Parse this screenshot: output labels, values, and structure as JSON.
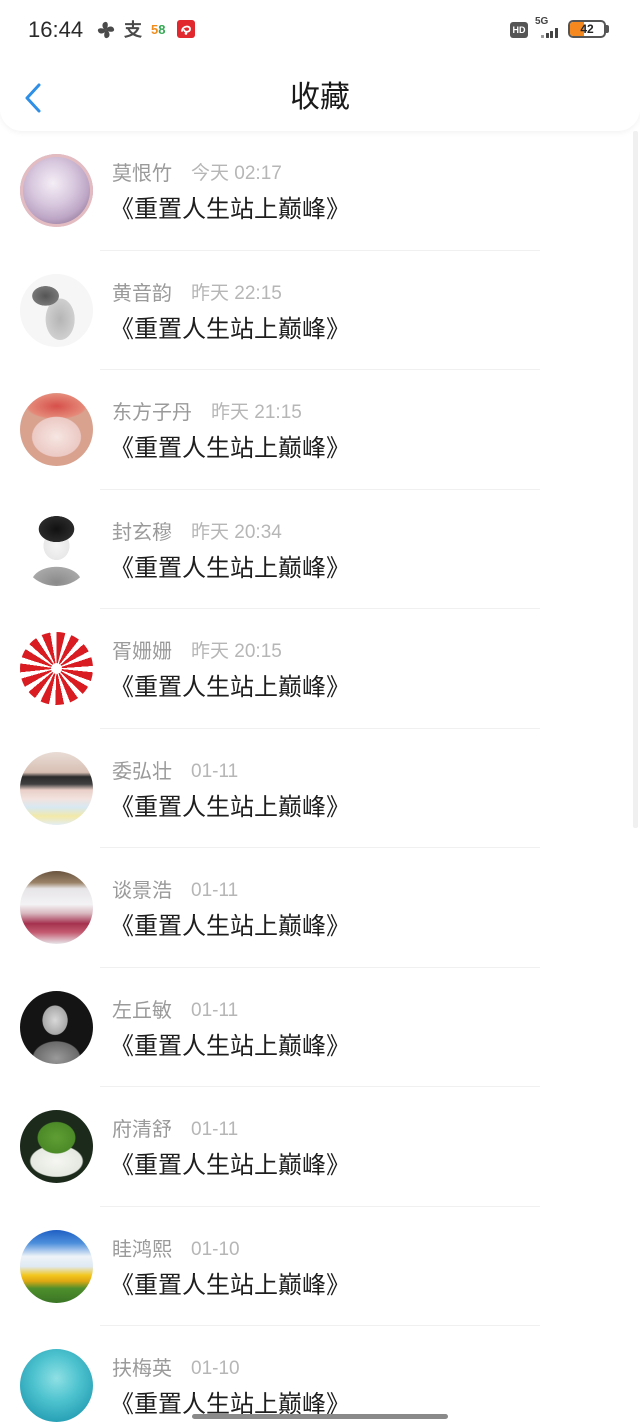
{
  "status_bar": {
    "time": "16:44",
    "app_icons": [
      {
        "icon": "pinwheel-icon"
      },
      {
        "icon": "alipay-icon",
        "glyph": "支"
      },
      {
        "icon": "58-app-icon",
        "glyph": "58"
      },
      {
        "icon": "red-app-icon"
      }
    ],
    "hd_label": "HD",
    "network_label": "5G",
    "battery": {
      "text": "42",
      "level": 0.42,
      "fill_color": "#f5891f"
    }
  },
  "header": {
    "back_icon": "chevron-left-icon",
    "title": "收藏"
  },
  "theme": {
    "accent": "#2f8fe6",
    "name_color": "#9a9a9a",
    "time_color": "#b6b6b6",
    "title_color": "#1e1e1e",
    "header_title_color": "#1a1a1a"
  },
  "items": [
    {
      "name": "莫恨竹",
      "time": "今天 02:17",
      "title": "《重置人生站上巅峰》"
    },
    {
      "name": "黄音韵",
      "time": "昨天 22:15",
      "title": "《重置人生站上巅峰》"
    },
    {
      "name": "东方子丹",
      "time": "昨天 21:15",
      "title": "《重置人生站上巅峰》"
    },
    {
      "name": "封玄穆",
      "time": "昨天 20:34",
      "title": "《重置人生站上巅峰》"
    },
    {
      "name": "胥姗姗",
      "time": "昨天 20:15",
      "title": "《重置人生站上巅峰》"
    },
    {
      "name": "委弘壮",
      "time": "01-11",
      "title": "《重置人生站上巅峰》"
    },
    {
      "name": "谈景浩",
      "time": "01-11",
      "title": "《重置人生站上巅峰》"
    },
    {
      "name": "左丘敏",
      "time": "01-11",
      "title": "《重置人生站上巅峰》"
    },
    {
      "name": "府清舒",
      "time": "01-11",
      "title": "《重置人生站上巅峰》"
    },
    {
      "name": "眭鸿熙",
      "time": "01-10",
      "title": "《重置人生站上巅峰》"
    },
    {
      "name": "扶梅英",
      "time": "01-10",
      "title": "《重置人生站上巅峰》"
    }
  ]
}
